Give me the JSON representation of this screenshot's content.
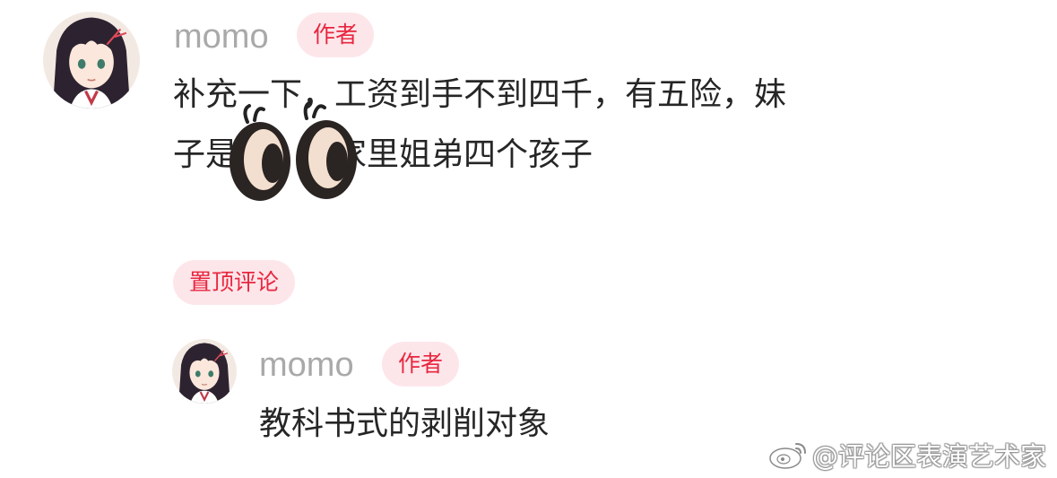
{
  "comment": {
    "username": "momo",
    "badge": "作者",
    "lines": [
      "补充一下，工资到手不到四千，有五险，妹",
      "子是　　　家里姐弟四个孩子"
    ]
  },
  "pinned_label": "置顶评论",
  "reply": {
    "username": "momo",
    "badge": "作者",
    "text": "教科书式的剥削对象"
  },
  "watermark": {
    "icon": "weibo-icon",
    "text": "@评论区表演艺术家"
  },
  "colors": {
    "badge_bg": "#fde6ea",
    "badge_text": "#e8263f",
    "username": "#a9a9a9",
    "body_text": "#262626"
  }
}
